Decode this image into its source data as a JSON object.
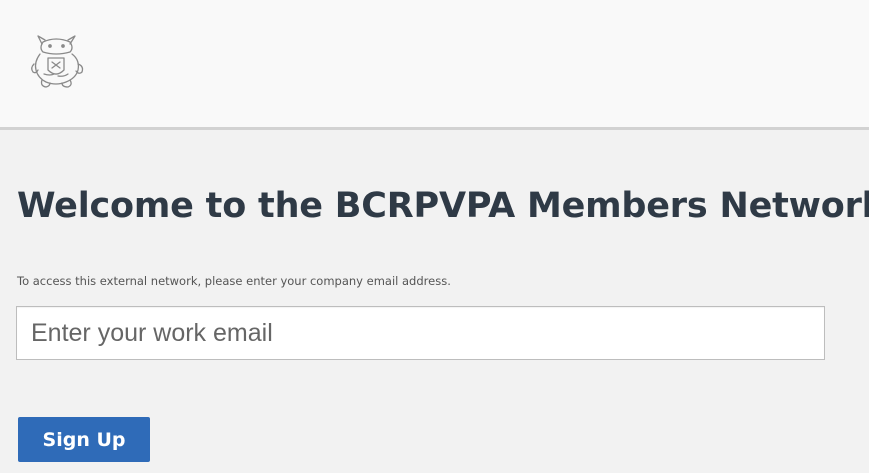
{
  "header": {
    "logo_icon": "bear-crest-logo-icon"
  },
  "main": {
    "title": "Welcome to the BCRPVPA Members Network",
    "instructions": "To access this external network, please enter your company email address.",
    "email_input": {
      "value": "",
      "placeholder": "Enter your work email"
    },
    "signup_button": {
      "label": "Sign Up"
    }
  },
  "colors": {
    "page_background": "#f2f2f2",
    "header_background": "#f9f9f9",
    "header_border": "#d2d2d2",
    "title_text": "#2f3a46",
    "button_background": "#2f6bb8",
    "button_text": "#ffffff"
  }
}
